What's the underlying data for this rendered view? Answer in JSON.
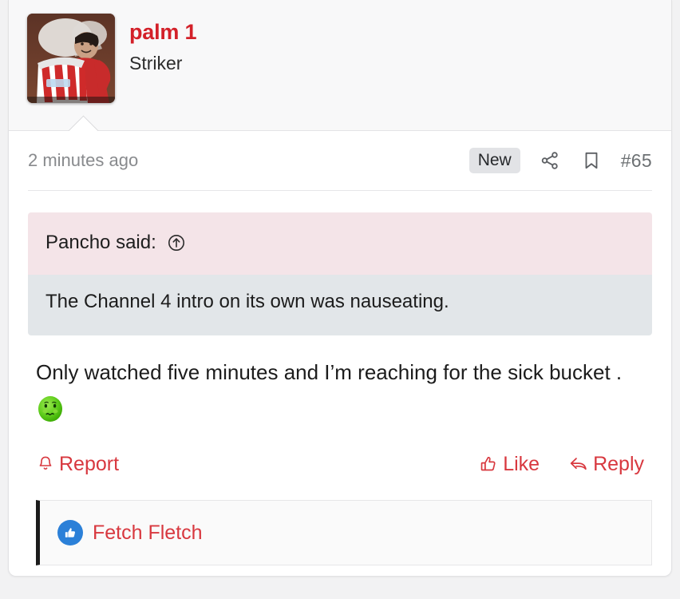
{
  "post": {
    "user": {
      "name": "palm 1",
      "title": "Striker",
      "avatar_alt": "footballer-holding-red-white-striped-jersey"
    },
    "meta": {
      "timestamp": "2 minutes ago",
      "new_badge": "New",
      "post_number": "#65",
      "share_icon": "share-nodes-icon",
      "bookmark_icon": "bookmark-icon"
    },
    "quote": {
      "author_label": "Pancho said:",
      "jump_icon": "arrow-up-circle-icon",
      "text": "The Channel 4 intro on its own was nauseating."
    },
    "message": {
      "text": "Only watched five minutes and I’m reaching for the sick bucket . ",
      "emoji": "nauseated-face"
    },
    "actions": {
      "report": "Report",
      "report_icon": "bell-icon",
      "like": "Like",
      "like_icon": "thumbs-up-icon",
      "reply": "Reply",
      "reply_icon": "reply-arrow-icon"
    },
    "likes": {
      "icon": "thumbs-up-filled-icon",
      "names": "Fetch Fletch"
    }
  },
  "colors": {
    "accent_red": "#d8383f",
    "username_red": "#d32029",
    "quote_head_pink": "#f4e4e8",
    "quote_body_gray": "#e2e6e9",
    "like_blue": "#2b80d8",
    "badge_gray": "#e2e3e6"
  }
}
